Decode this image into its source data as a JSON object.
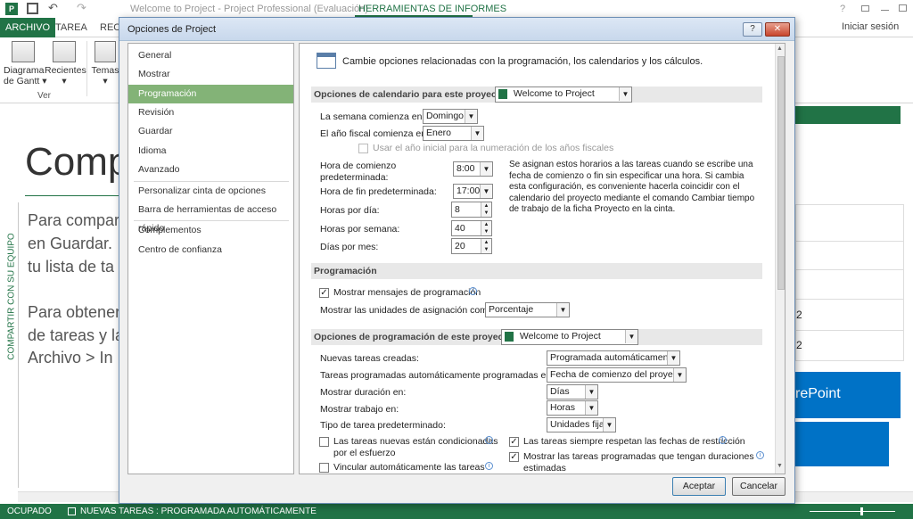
{
  "titlebar": {
    "title": "Welcome to Project - Project Professional (Evaluación)",
    "context_tab": "HERRAMIENTAS DE INFORMES",
    "help": "?",
    "signin": "Iniciar sesión"
  },
  "ribbon": {
    "tabs": [
      "ARCHIVO",
      "TAREA",
      "RECU"
    ],
    "buttons": [
      {
        "label": "Diagrama\nde Gantt ▾"
      },
      {
        "label": "Recientes\n▾"
      },
      {
        "label": "Temas\n▾"
      }
    ],
    "group_label": "Ver"
  },
  "background": {
    "heading": "Comp",
    "side_label": "COMPARTIR CON SU EQUIPO",
    "lines": [
      "Para compar",
      "en Guardar.",
      "tu lista de ta",
      "Para obtener",
      "de tareas y la",
      "Archivo > In"
    ],
    "table_values": [
      "2",
      "2"
    ],
    "sharepoint": "rePoint"
  },
  "status": {
    "mode": "OCUPADO",
    "tasks": "NUEVAS TAREAS : PROGRAMADA AUTOMÁTICAMENTE",
    "colors": {
      "bar": "#217346"
    }
  },
  "dialog": {
    "title": "Opciones de Project",
    "help_btn": "?",
    "close_btn": "✕",
    "nav": [
      "General",
      "Mostrar",
      "Programación",
      "Revisión",
      "Guardar",
      "Idioma",
      "Avanzado",
      "Personalizar cinta de opciones",
      "Barra de herramientas de acceso rápido",
      "Complementos",
      "Centro de confianza"
    ],
    "selected_nav": "Programación",
    "intro": "Cambie opciones relacionadas con la programación, los calendarios y los cálculos.",
    "calendar": {
      "header": "Opciones de calendario para este proyecto:",
      "project": "Welcome to Project",
      "week_start_label": "La semana comienza en:",
      "week_start": "Domingo",
      "fiscal_label": "El año fiscal comienza en:",
      "fiscal": "Enero",
      "use_start_year": "Usar el año inicial para la numeración de los años fiscales",
      "start_time_label_1": "Hora de comienzo",
      "start_time_label_2": "predeterminada:",
      "start_time": "8:00",
      "end_time_label": "Hora de fin predeterminada:",
      "end_time": "17:00",
      "hours_day_label": "Horas por día:",
      "hours_day": "8",
      "hours_week_label": "Horas por semana:",
      "hours_week": "40",
      "days_month_label": "Días por mes:",
      "days_month": "20",
      "note": "Se asignan estos horarios a las tareas cuando se escribe una fecha de comienzo o fin sin especificar una hora. Si cambia esta configuración, es conveniente hacerla coincidir con el calendario del proyecto mediante el comando Cambiar tiempo de trabajo de la ficha Proyecto en la cinta."
    },
    "scheduling": {
      "header": "Programación",
      "show_messages": "Mostrar mensajes de programación",
      "units_label": "Mostrar las unidades de asignación como:",
      "units": "Porcentaje"
    },
    "project_sched": {
      "header": "Opciones de programación de este proyecto:",
      "project": "Welcome to Project",
      "new_tasks_label": "Nuevas tareas creadas:",
      "new_tasks": "Programada automáticamente",
      "auto_label": "Tareas programadas automáticamente programadas en la:",
      "auto": "Fecha de comienzo del proyecto",
      "duration_label": "Mostrar duración en:",
      "duration": "Días",
      "work_label": "Mostrar trabajo en:",
      "work": "Horas",
      "type_label": "Tipo de tarea predeterminado:",
      "type": "Unidades fijas",
      "effort_1": "Las tareas nuevas están condicionadas",
      "effort_2": "por el esfuerzo",
      "link_tasks": "Vincular automáticamente las tareas",
      "respect_dates": "Las tareas siempre respetan las fechas de restricción",
      "estimated_1": "Mostrar las tareas programadas que tengan duraciones",
      "estimated_2": "estimadas"
    },
    "ok": "Aceptar",
    "cancel": "Cancelar"
  }
}
